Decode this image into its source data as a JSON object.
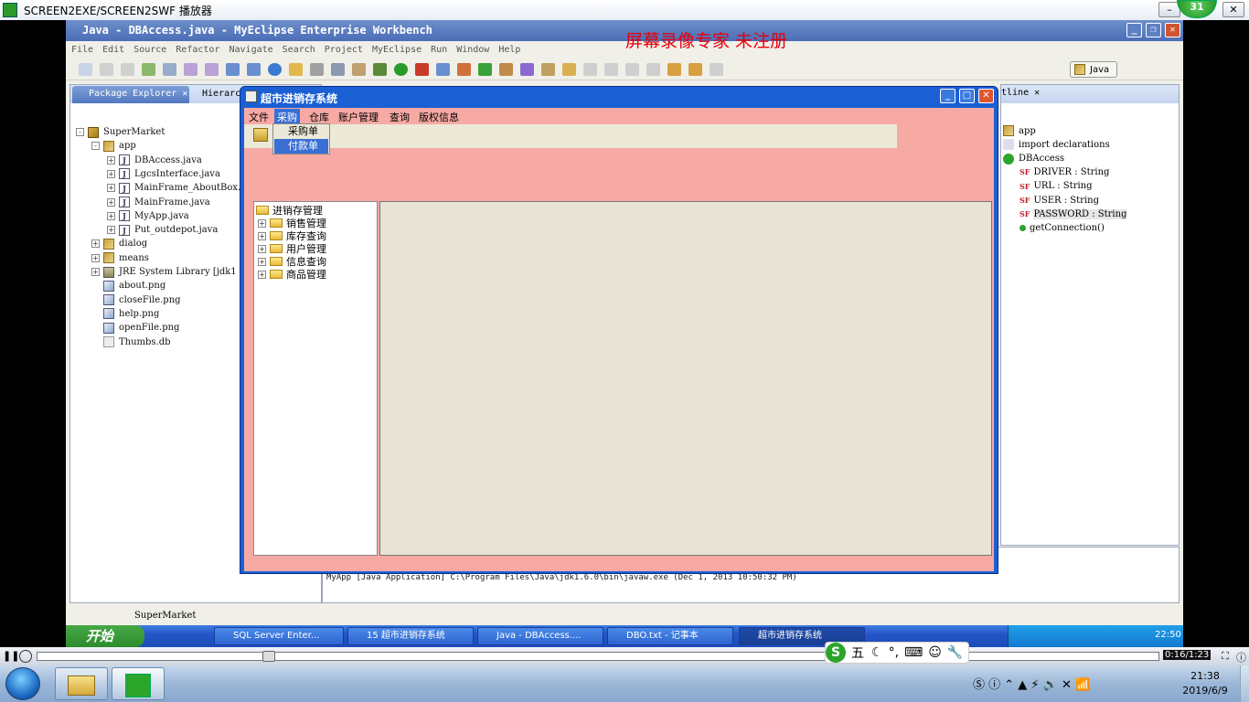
{
  "player": {
    "title": "SCREEN2EXE/SCREEN2SWF 播放器",
    "badge": "31",
    "time": "0:16/1:23"
  },
  "watermark": "屏幕录像专家  未注册",
  "eclipse": {
    "title": "Java - DBAccess.java - MyEclipse Enterprise Workbench",
    "menu": [
      "File",
      "Edit",
      "Source",
      "Refactor",
      "Navigate",
      "Search",
      "Project",
      "MyEclipse",
      "Run",
      "Window",
      "Help"
    ],
    "perspective": "Java",
    "pkg_tab": "Package Explorer",
    "pkg_tab2": "Hierarcl",
    "tree": [
      {
        "label": "SuperMarket",
        "kind": "proj",
        "level": 0,
        "pm": "-"
      },
      {
        "label": "app",
        "kind": "pkg",
        "level": 1,
        "pm": "-"
      },
      {
        "label": "DBAccess.java",
        "kind": "jf",
        "level": 2,
        "pm": "+"
      },
      {
        "label": "LgcsInterface.java",
        "kind": "jf",
        "level": 2,
        "pm": "+"
      },
      {
        "label": "MainFrame_AboutBox.ja",
        "kind": "jf",
        "level": 2,
        "pm": "+"
      },
      {
        "label": "MainFrame.java",
        "kind": "jf",
        "level": 2,
        "pm": "+"
      },
      {
        "label": "MyApp.java",
        "kind": "jf",
        "level": 2,
        "pm": "+"
      },
      {
        "label": "Put_outdepot.java",
        "kind": "jf",
        "level": 2,
        "pm": "+"
      },
      {
        "label": "dialog",
        "kind": "pkg",
        "level": 1,
        "pm": "+"
      },
      {
        "label": "means",
        "kind": "pkg",
        "level": 1,
        "pm": "+"
      },
      {
        "label": "JRE System Library [jdk1",
        "kind": "lib",
        "level": 1,
        "pm": "+"
      },
      {
        "label": "about.png",
        "kind": "img",
        "level": 1,
        "pm": ""
      },
      {
        "label": "closeFile.png",
        "kind": "img",
        "level": 1,
        "pm": ""
      },
      {
        "label": "help.png",
        "kind": "img",
        "level": 1,
        "pm": ""
      },
      {
        "label": "openFile.png",
        "kind": "img",
        "level": 1,
        "pm": ""
      },
      {
        "label": "Thumbs.db",
        "kind": "db",
        "level": 1,
        "pm": ""
      }
    ],
    "outline_tab": "tline",
    "outline": [
      {
        "label": "app",
        "kind": "pkg"
      },
      {
        "label": "import declarations",
        "kind": "imp"
      },
      {
        "label": "DBAccess",
        "kind": "cls"
      },
      {
        "label": "DRIVER : String",
        "kind": "fld"
      },
      {
        "label": "URL : String",
        "kind": "fld"
      },
      {
        "label": "USER : String",
        "kind": "fld"
      },
      {
        "label": "PASSWORD : String",
        "kind": "fld"
      },
      {
        "label": "getConnection()",
        "kind": "meth"
      }
    ],
    "console_text": "MyApp [Java Application] C:\\Program Files\\Java\\jdk1.6.0\\bin\\javaw.exe (Dec 1, 2013 10:50:32 PM)",
    "status_text": "SuperMarket"
  },
  "app": {
    "title": "超市进销存系统",
    "menu": [
      "文件",
      "采购",
      "仓库",
      "账户管理",
      "查询",
      "版权信息"
    ],
    "dropdown": [
      "采购单",
      "付款单"
    ],
    "tree_root": "进销存管理",
    "tree_items": [
      "销售管理",
      "库存查询",
      "用户管理",
      "信息查询",
      "商品管理"
    ]
  },
  "xp_taskbar": {
    "start": "开始",
    "items": [
      "SQL Server Enter...",
      "15 超市进销存系统",
      "Java - DBAccess....",
      "DBO.txt - 记事本",
      "超市进销存系统"
    ],
    "time": "22:50"
  },
  "ime": {
    "label": "五"
  },
  "win7": {
    "time": "21:38",
    "date": "2019/6/9"
  }
}
